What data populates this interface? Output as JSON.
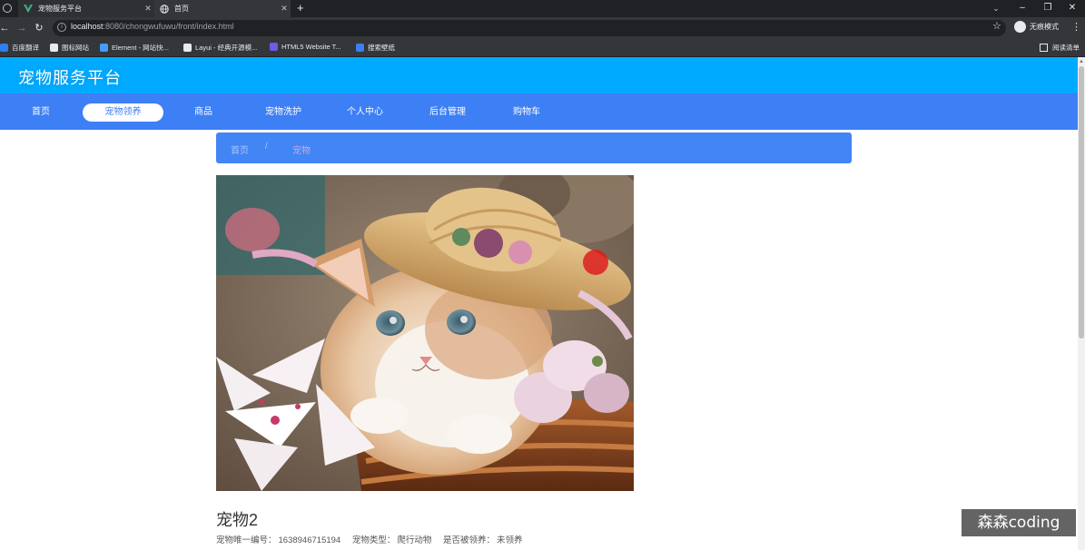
{
  "browser": {
    "tabs": [
      {
        "title": "宠物服务平台",
        "icon": "vue-logo-icon"
      },
      {
        "title": "首页",
        "icon": "globe-icon"
      }
    ],
    "url": {
      "host": "localhost",
      "rest": ":8080/chongwufuwu/front/index.html"
    },
    "profile_label": "无痕模式",
    "bookmarks": [
      {
        "label": "百度翻译",
        "color": "#2f80ed"
      },
      {
        "label": "图标网站",
        "color": "#e8eaed"
      },
      {
        "label": "Element - 网站快...",
        "color": "#409eff"
      },
      {
        "label": "Layui - 经典开源模...",
        "color": "#e8eaed"
      },
      {
        "label": "HTML5 Website T...",
        "color": "#6c5ce7"
      },
      {
        "label": "搜索壁纸",
        "color": "#3d7ff5"
      }
    ],
    "reading_list": "阅读清单"
  },
  "site": {
    "title": "宠物服务平台",
    "nav": [
      {
        "label": "首页",
        "active": false
      },
      {
        "label": "宠物领养",
        "active": true
      },
      {
        "label": "商品",
        "active": false
      },
      {
        "label": "宠物洗护",
        "active": false
      },
      {
        "label": "个人中心",
        "active": false
      },
      {
        "label": "后台管理",
        "active": false
      },
      {
        "label": "购物车",
        "active": false
      }
    ],
    "breadcrumb": {
      "home": "首页",
      "separator": "/",
      "current": "宠物"
    }
  },
  "pet": {
    "name": "宠物2",
    "id_label": "宠物唯一编号：",
    "id_value": "1638946715194",
    "type_label": "宠物类型：",
    "type_value": "爬行动物",
    "adopted_label": "是否被领养：",
    "adopted_value": "未领养"
  },
  "watermark": "森森coding",
  "colors": {
    "header": "#00aaff",
    "navbar": "#3d7ff5",
    "breadcrumb": "#4285f4"
  }
}
